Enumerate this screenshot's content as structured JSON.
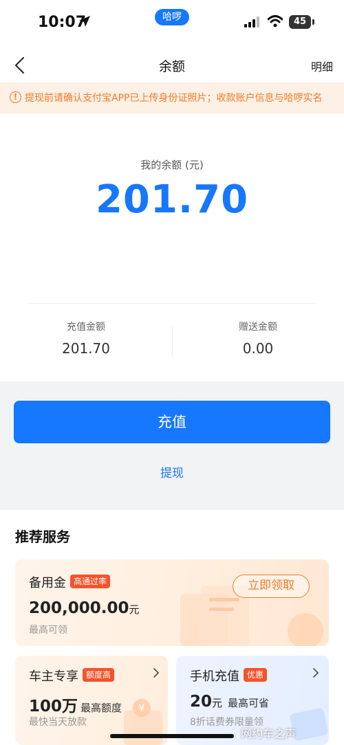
{
  "status_bar": {
    "time": "10:07",
    "pill": "哈啰",
    "battery": "45"
  },
  "nav": {
    "title": "余额",
    "right": "明细"
  },
  "notice": {
    "text": "提现前请确认支付宝APP已上传身份证照片；收款账户信息与哈啰实名"
  },
  "balance": {
    "label": "我的余额 (元)",
    "amount": "201.70",
    "recharge_label": "充值金额",
    "recharge_value": "201.70",
    "gift_label": "赠送金额",
    "gift_value": "0.00"
  },
  "actions": {
    "recharge": "充值",
    "withdraw": "提现"
  },
  "services": {
    "title": "推荐服务",
    "main": {
      "title": "备用金",
      "tag": "高通过率",
      "amount": "200,000.00",
      "unit": "元",
      "desc": "最高可领",
      "button": "立即领取"
    },
    "left": {
      "title": "车主专享",
      "tag": "额度高",
      "amount": "100万",
      "amount_suffix": "最高额度",
      "desc": "最快当天放款"
    },
    "right": {
      "title": "手机充值",
      "tag": "优惠",
      "amount": "20",
      "unit": "元",
      "amount_suffix": "最高可省",
      "desc": "8折话费券限量领"
    }
  },
  "watermark": "网约车之声",
  "colors": {
    "accent": "#1677ff",
    "notice": "#f07b2a",
    "tag": "#f4532b"
  }
}
